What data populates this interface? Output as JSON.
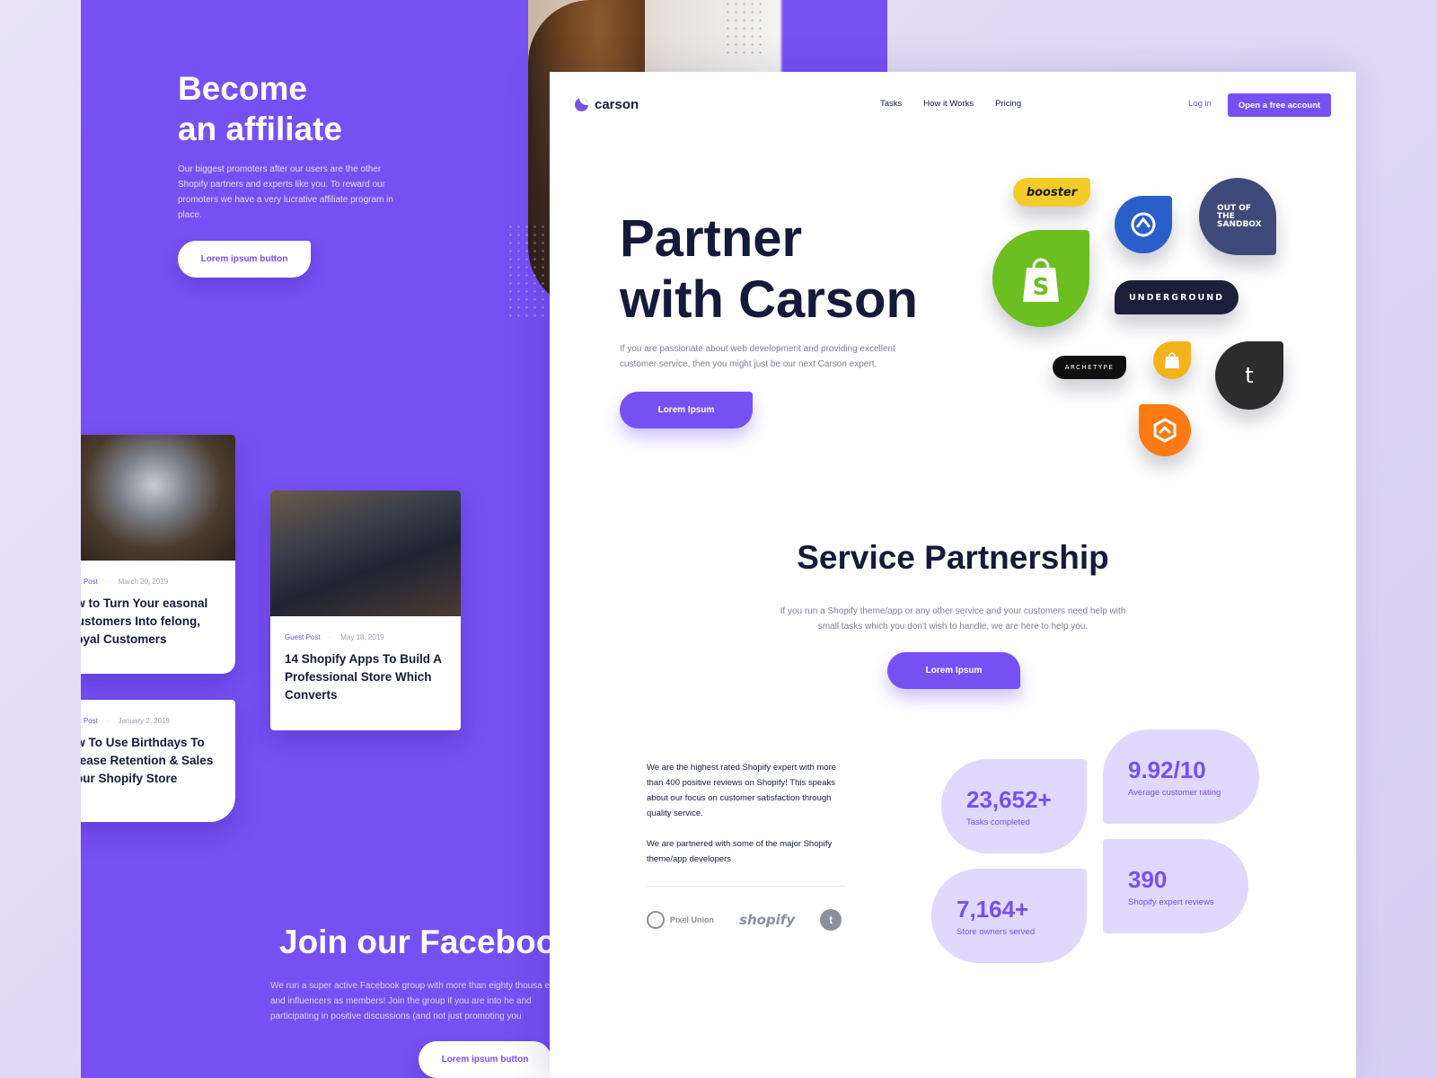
{
  "affiliate": {
    "title": "Become\nan affiliate",
    "text": "Our biggest promoters after our users are the other Shopify partners and experts like you. To reward our promoters we have a very lucrative affiliate program in place.",
    "button": "Lorem ipsum button"
  },
  "blog": [
    {
      "tag": "est Post",
      "date": "March 20, 2019",
      "title": "ow to Turn Your easonal Customers Into fe​long, Loyal Customers"
    },
    {
      "tag": "Guest Post",
      "date": "May 18, 2019",
      "title": "14 Shopify Apps To Build A Professional Store Which Converts"
    },
    {
      "tag": "est Post",
      "date": "January 2, 2019",
      "title": "ow To Use Birthdays To crease Retention & Sales Your Shopify Store"
    }
  ],
  "facebook": {
    "title": "Join our Faceboo",
    "text": "We run a super active Facebook group with more than eighty thousa experts and influencers as members! Join the group if you are into he and participating in positive discussions (and not just promoting you",
    "button": "Lorem ipsum button"
  },
  "header": {
    "brand": "carson",
    "nav": [
      "Tasks",
      "How it Works",
      "Pricing"
    ],
    "login": "Log in",
    "cta": "Open a free account"
  },
  "hero": {
    "title": "Partner\nwith Carson",
    "text": "If you are passionate about web development and providing excellent customer service, then you might just be our next Carson expert.",
    "button": "Lorem Ipsum"
  },
  "brands": {
    "booster": "booster",
    "sandbox": "OUT OF THE SANDBOX",
    "underground": "UNDERGROUND",
    "archetype": "ARCHETYPE",
    "timber": "t"
  },
  "service": {
    "title": "Service Partnership",
    "text": "If you run a Shopify theme/app or any other service and your customers need help with small tasks which you don't wish to handle, we are here to help you.",
    "button": "Lorem Ipsum"
  },
  "stats_intro": {
    "p1": "We are the highest rated Shopify expert with more than 400 positive reviews on Shopify! This speaks about our focus on customer satisfaction through quality service.",
    "p2": "We are partnered with some of the major Shopify theme/app developers"
  },
  "partners": {
    "pixel_union": "Pixel Union",
    "shopify": "shopify",
    "timber": "t"
  },
  "stats": [
    {
      "num": "23,652+",
      "label": "Tasks completed"
    },
    {
      "num": "9.92/10",
      "label": "Average customer rating"
    },
    {
      "num": "7,164+",
      "label": "Store owners served"
    },
    {
      "num": "390",
      "label": "Shopify expert reviews"
    }
  ],
  "colors": {
    "accent": "#7650f3",
    "dark": "#141b3a",
    "stat_bg": "#e0d8fd"
  }
}
